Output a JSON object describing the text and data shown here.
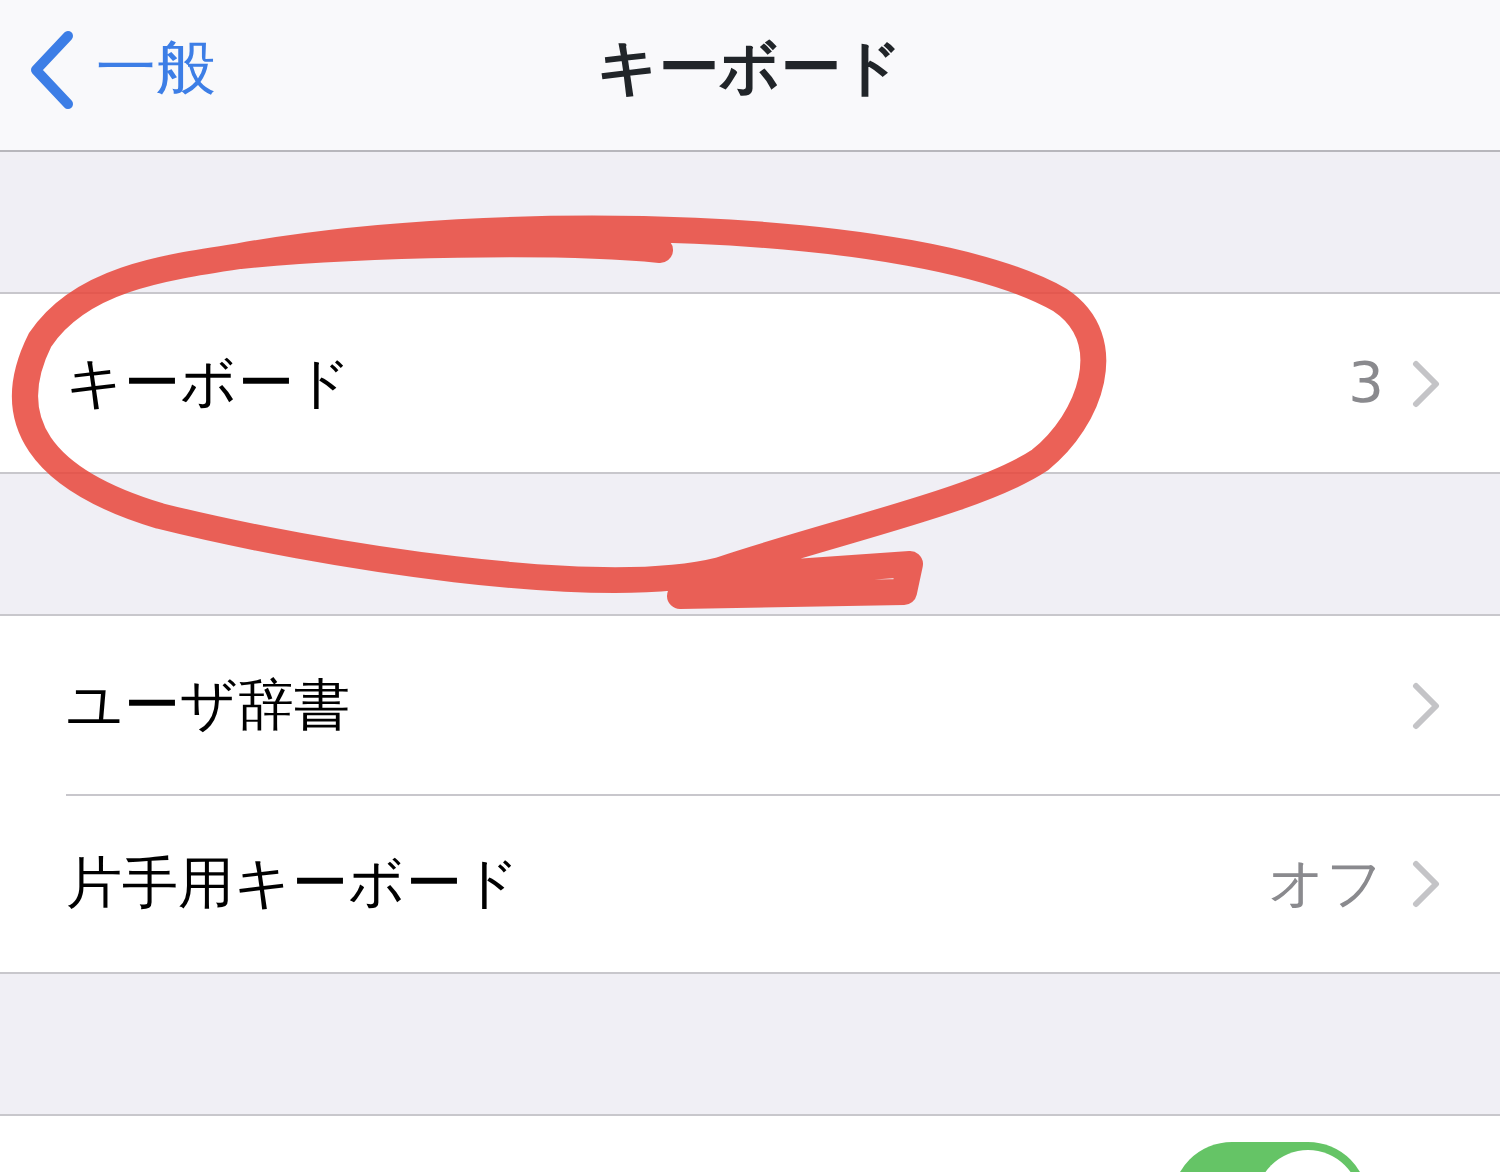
{
  "nav": {
    "back_label": "一般",
    "title": "キーボード"
  },
  "groups": [
    {
      "rows": [
        {
          "kind": "link",
          "label": "キーボード",
          "value": "3"
        }
      ]
    },
    {
      "rows": [
        {
          "kind": "link",
          "label": "ユーザ辞書"
        },
        {
          "kind": "link",
          "label": "片手用キーボード",
          "value": "オフ"
        }
      ]
    },
    {
      "rows": [
        {
          "kind": "toggle",
          "on": true
        }
      ]
    }
  ]
}
